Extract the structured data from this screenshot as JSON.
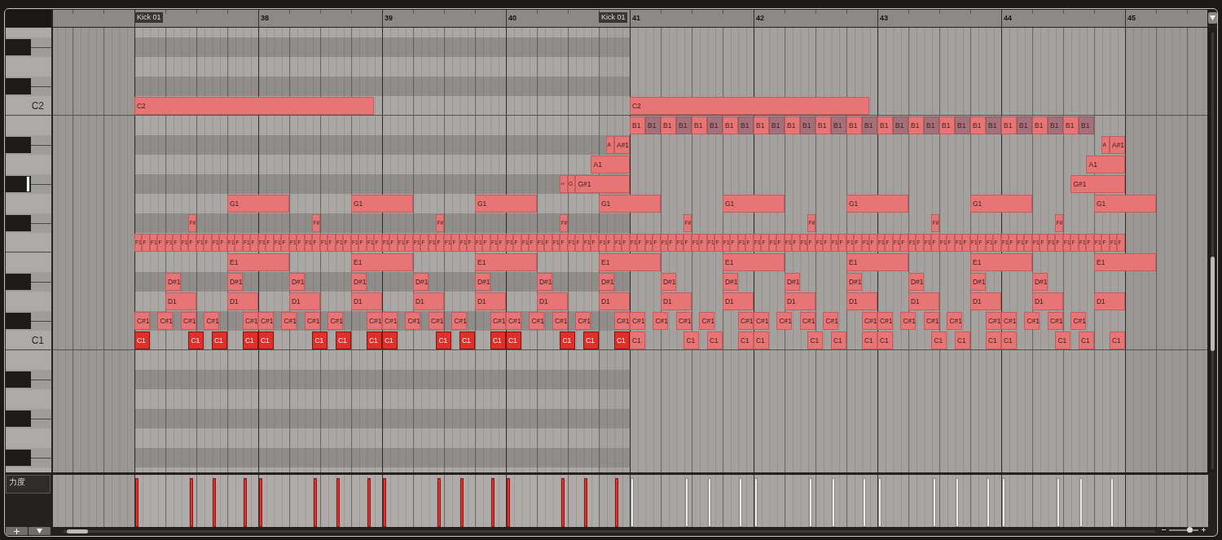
{
  "clips": [
    {
      "label": "Kick 01",
      "active": true
    },
    {
      "label": "Kick 01",
      "active": false
    }
  ],
  "ruler": {
    "marks": [
      {
        "label": "38"
      },
      {
        "label": "39"
      },
      {
        "label": "40"
      },
      {
        "label": "41"
      },
      {
        "label": "42"
      },
      {
        "label": "43"
      },
      {
        "label": "44"
      },
      {
        "label": "45"
      }
    ]
  },
  "lanes": [
    {
      "kind": "natural",
      "pressed": false
    },
    {
      "kind": "sharp",
      "pressed": false
    },
    {
      "kind": "natural",
      "pressed": false
    },
    {
      "kind": "sharp",
      "pressed": false
    },
    {
      "kind": "natural",
      "label": "C2",
      "pressed": false,
      "notes": [
        {
          "label": "C2"
        },
        {
          "label": "C2"
        }
      ]
    },
    {
      "kind": "natural",
      "pressed": false,
      "notes": [
        {
          "label": "B1",
          "muted": false
        },
        {
          "label": "B1",
          "muted": true
        },
        {
          "label": "B1",
          "muted": false
        },
        {
          "label": "B1",
          "muted": true
        },
        {
          "label": "B1",
          "muted": false
        },
        {
          "label": "B1",
          "muted": true
        },
        {
          "label": "B1",
          "muted": false
        },
        {
          "label": "B1",
          "muted": true
        },
        {
          "label": "B1",
          "muted": false
        },
        {
          "label": "B1",
          "muted": true
        },
        {
          "label": "B1",
          "muted": false
        },
        {
          "label": "B1",
          "muted": true
        },
        {
          "label": "B1",
          "muted": false
        },
        {
          "label": "B1",
          "muted": true
        },
        {
          "label": "B1",
          "muted": false
        },
        {
          "label": "B1",
          "muted": true
        },
        {
          "label": "B1",
          "muted": false
        },
        {
          "label": "B1",
          "muted": true
        },
        {
          "label": "B1",
          "muted": false
        },
        {
          "label": "B1",
          "muted": true
        },
        {
          "label": "B1",
          "muted": false
        },
        {
          "label": "B1",
          "muted": true
        },
        {
          "label": "B1",
          "muted": false
        },
        {
          "label": "B1",
          "muted": true
        },
        {
          "label": "B1",
          "muted": false
        },
        {
          "label": "B1",
          "muted": true
        },
        {
          "label": "B1",
          "muted": false
        },
        {
          "label": "B1",
          "muted": true
        },
        {
          "label": "B1",
          "muted": false
        },
        {
          "label": "B1",
          "muted": true
        }
      ]
    },
    {
      "kind": "sharp",
      "pressed": false,
      "notes": [
        {
          "label": "A"
        },
        {
          "label": "A#1"
        },
        {
          "label": "A"
        },
        {
          "label": "A#1"
        }
      ]
    },
    {
      "kind": "natural",
      "pressed": false,
      "notes": [
        {
          "label": "A1"
        },
        {
          "label": "A1"
        }
      ]
    },
    {
      "kind": "sharp",
      "pressed": true,
      "notes": [
        {
          "label": "‹‹"
        },
        {
          "label": "G"
        },
        {
          "label": "G#1"
        },
        {
          "label": "G#1"
        }
      ]
    },
    {
      "kind": "natural",
      "pressed": false,
      "notes": [
        {
          "label": "G1"
        },
        {
          "label": "G1"
        },
        {
          "label": "G1"
        },
        {
          "label": "G1"
        },
        {
          "label": "G1"
        },
        {
          "label": "G1"
        },
        {
          "label": "G1"
        },
        {
          "label": "G1"
        }
      ]
    },
    {
      "kind": "sharp",
      "pressed": false,
      "notes": [
        {
          "label": "F#"
        },
        {
          "label": "F#"
        },
        {
          "label": "F#"
        },
        {
          "label": "F#"
        },
        {
          "label": "F#"
        },
        {
          "label": "F#"
        },
        {
          "label": "F#"
        },
        {
          "label": "F#"
        }
      ]
    },
    {
      "kind": "natural",
      "pressed": false,
      "notes": [
        {
          "label": "F1"
        },
        {
          "label": "F"
        },
        {
          "label": "F1"
        },
        {
          "label": "F"
        },
        {
          "label": "F1"
        },
        {
          "label": "F"
        },
        {
          "label": "F1"
        },
        {
          "label": "F"
        },
        {
          "label": "F1"
        },
        {
          "label": "F"
        },
        {
          "label": "F1"
        },
        {
          "label": "F"
        },
        {
          "label": "F1"
        },
        {
          "label": "F"
        },
        {
          "label": "F1"
        },
        {
          "label": "F"
        },
        {
          "label": "F1"
        },
        {
          "label": "F"
        },
        {
          "label": "F1"
        },
        {
          "label": "F"
        },
        {
          "label": "F1"
        },
        {
          "label": "F"
        },
        {
          "label": "F1"
        },
        {
          "label": "F"
        },
        {
          "label": "F1"
        },
        {
          "label": "F"
        },
        {
          "label": "F1"
        },
        {
          "label": "F"
        },
        {
          "label": "F1"
        },
        {
          "label": "F"
        },
        {
          "label": "F1"
        },
        {
          "label": "F"
        },
        {
          "label": "F1"
        },
        {
          "label": "F"
        },
        {
          "label": "F1"
        },
        {
          "label": "F"
        },
        {
          "label": "F1"
        },
        {
          "label": "F"
        },
        {
          "label": "F1"
        },
        {
          "label": "F"
        },
        {
          "label": "F1"
        },
        {
          "label": "F"
        },
        {
          "label": "F1"
        },
        {
          "label": "F"
        },
        {
          "label": "F1"
        },
        {
          "label": "F"
        },
        {
          "label": "F1"
        },
        {
          "label": "F"
        },
        {
          "label": "F1"
        },
        {
          "label": "F"
        },
        {
          "label": "F1"
        },
        {
          "label": "F"
        },
        {
          "label": "F1"
        },
        {
          "label": "F"
        },
        {
          "label": "F1"
        },
        {
          "label": "F"
        },
        {
          "label": "F1"
        },
        {
          "label": "F"
        },
        {
          "label": "F1"
        },
        {
          "label": "F"
        },
        {
          "label": "F1"
        },
        {
          "label": "F"
        },
        {
          "label": "F1"
        },
        {
          "label": "F"
        },
        {
          "label": "F1"
        },
        {
          "label": "F"
        },
        {
          "label": "F1"
        },
        {
          "label": "F"
        },
        {
          "label": "F1"
        },
        {
          "label": "F"
        },
        {
          "label": "F1"
        },
        {
          "label": "F"
        },
        {
          "label": "F1"
        },
        {
          "label": "F"
        },
        {
          "label": "F1"
        },
        {
          "label": "F"
        },
        {
          "label": "F1"
        },
        {
          "label": "F"
        },
        {
          "label": "F1"
        },
        {
          "label": "F"
        },
        {
          "label": "F1"
        },
        {
          "label": "F"
        },
        {
          "label": "F1"
        },
        {
          "label": "F"
        },
        {
          "label": "F1"
        },
        {
          "label": "F"
        },
        {
          "label": "F1"
        },
        {
          "label": "F"
        },
        {
          "label": "F1"
        },
        {
          "label": "F"
        },
        {
          "label": "F1"
        },
        {
          "label": "F"
        },
        {
          "label": "F1"
        },
        {
          "label": "F"
        },
        {
          "label": "F1"
        },
        {
          "label": "F"
        },
        {
          "label": "F1"
        },
        {
          "label": "F"
        },
        {
          "label": "F1"
        },
        {
          "label": "F"
        },
        {
          "label": "F1"
        },
        {
          "label": "F"
        },
        {
          "label": "F1"
        },
        {
          "label": "F"
        },
        {
          "label": "F1"
        },
        {
          "label": "F"
        },
        {
          "label": "F1"
        },
        {
          "label": "F"
        },
        {
          "label": "F1"
        },
        {
          "label": "F"
        },
        {
          "label": "F1"
        },
        {
          "label": "F"
        },
        {
          "label": "F1"
        },
        {
          "label": "F"
        },
        {
          "label": "F1"
        },
        {
          "label": "F"
        },
        {
          "label": "F1"
        },
        {
          "label": "F"
        },
        {
          "label": "F1"
        },
        {
          "label": "F"
        },
        {
          "label": "F1"
        },
        {
          "label": "F"
        },
        {
          "label": "F1"
        },
        {
          "label": "F"
        },
        {
          "label": "F1"
        },
        {
          "label": "F"
        },
        {
          "label": "F1"
        },
        {
          "label": "F"
        }
      ]
    },
    {
      "kind": "natural",
      "pressed": false,
      "notes": [
        {
          "label": "E1"
        },
        {
          "label": "E1"
        },
        {
          "label": "E1"
        },
        {
          "label": "E1"
        },
        {
          "label": "E1"
        },
        {
          "label": "E1"
        },
        {
          "label": "E1"
        },
        {
          "label": "E1"
        }
      ]
    },
    {
      "kind": "sharp",
      "pressed": false,
      "notes": [
        {
          "label": "D#1"
        },
        {
          "label": "D#1"
        },
        {
          "label": "D#1"
        },
        {
          "label": "D#1"
        },
        {
          "label": "D#1"
        },
        {
          "label": "D#1"
        },
        {
          "label": "D#1"
        },
        {
          "label": "D#1"
        },
        {
          "label": "D#1"
        },
        {
          "label": "D#1"
        },
        {
          "label": "D#1"
        },
        {
          "label": "D#1"
        },
        {
          "label": "D#1"
        },
        {
          "label": "D#1"
        },
        {
          "label": "D#1"
        }
      ]
    },
    {
      "kind": "natural",
      "pressed": false,
      "notes": [
        {
          "label": "D1"
        },
        {
          "label": "D1"
        },
        {
          "label": "D1"
        },
        {
          "label": "D1"
        },
        {
          "label": "D1"
        },
        {
          "label": "D1"
        },
        {
          "label": "D1"
        },
        {
          "label": "D1"
        },
        {
          "label": "D1"
        },
        {
          "label": "D1"
        },
        {
          "label": "D1"
        },
        {
          "label": "D1"
        },
        {
          "label": "D1"
        },
        {
          "label": "D1"
        },
        {
          "label": "D1"
        },
        {
          "label": "D1"
        }
      ]
    },
    {
      "kind": "sharp",
      "pressed": false,
      "notes": [
        {
          "label": "C#1"
        },
        {
          "label": "C#1"
        },
        {
          "label": "C#1"
        },
        {
          "label": "C#1"
        },
        {
          "label": "C#1"
        },
        {
          "label": "C#1"
        },
        {
          "label": "C#1"
        },
        {
          "label": "C#1"
        },
        {
          "label": "C#1"
        },
        {
          "label": "C#1"
        },
        {
          "label": "C#1"
        },
        {
          "label": "C#1"
        },
        {
          "label": "C#1"
        },
        {
          "label": "C#1"
        },
        {
          "label": "C#1"
        },
        {
          "label": "C#1"
        },
        {
          "label": "C#1"
        },
        {
          "label": "C#1"
        },
        {
          "label": "C#1"
        },
        {
          "label": "C#1"
        },
        {
          "label": "C#1"
        },
        {
          "label": "C#1"
        },
        {
          "label": "C#1"
        },
        {
          "label": "C#1"
        },
        {
          "label": "C#1"
        },
        {
          "label": "C#1"
        },
        {
          "label": "C#1"
        },
        {
          "label": "C#1"
        },
        {
          "label": "C#1"
        },
        {
          "label": "C#1"
        },
        {
          "label": "C#1"
        },
        {
          "label": "C#1"
        },
        {
          "label": "C#1"
        },
        {
          "label": "C#1"
        },
        {
          "label": "C#1"
        },
        {
          "label": "C#1"
        },
        {
          "label": "C#1"
        },
        {
          "label": "C#1"
        },
        {
          "label": "C#1"
        }
      ]
    },
    {
      "kind": "natural",
      "label": "C1",
      "pressed": false,
      "notes": [
        {
          "label": "C1",
          "selected": true
        },
        {
          "label": "C1",
          "selected": true
        },
        {
          "label": "C1",
          "selected": true
        },
        {
          "label": "C1",
          "selected": true
        },
        {
          "label": "C1",
          "selected": true
        },
        {
          "label": "C1",
          "selected": true
        },
        {
          "label": "C1",
          "selected": true
        },
        {
          "label": "C1",
          "selected": true
        },
        {
          "label": "C1",
          "selected": true
        },
        {
          "label": "C1",
          "selected": true
        },
        {
          "label": "C1",
          "selected": true
        },
        {
          "label": "C1",
          "selected": true
        },
        {
          "label": "C1",
          "selected": true
        },
        {
          "label": "C1",
          "selected": true
        },
        {
          "label": "C1",
          "selected": true
        },
        {
          "label": "C1",
          "selected": true
        },
        {
          "label": "C1",
          "selected": false
        },
        {
          "label": "C1",
          "selected": false
        },
        {
          "label": "C1",
          "selected": false
        },
        {
          "label": "C1",
          "selected": false
        },
        {
          "label": "C1",
          "selected": false
        },
        {
          "label": "C1",
          "selected": false
        },
        {
          "label": "C1",
          "selected": false
        },
        {
          "label": "C1",
          "selected": false
        },
        {
          "label": "C1",
          "selected": false
        },
        {
          "label": "C1",
          "selected": false
        },
        {
          "label": "C1",
          "selected": false
        },
        {
          "label": "C1",
          "selected": false
        },
        {
          "label": "C1",
          "selected": false
        },
        {
          "label": "C1",
          "selected": false
        },
        {
          "label": "C1",
          "selected": false
        },
        {
          "label": "C1",
          "selected": false
        }
      ]
    },
    {
      "kind": "natural",
      "pressed": false
    },
    {
      "kind": "sharp",
      "pressed": false
    },
    {
      "kind": "natural",
      "pressed": false
    },
    {
      "kind": "sharp",
      "pressed": false
    },
    {
      "kind": "natural",
      "pressed": false
    },
    {
      "kind": "sharp",
      "pressed": false
    },
    {
      "kind": "natural",
      "pressed": false
    }
  ],
  "velocity_lane": {
    "label": "力度"
  },
  "zoom_slider": {
    "level": 0.7
  }
}
